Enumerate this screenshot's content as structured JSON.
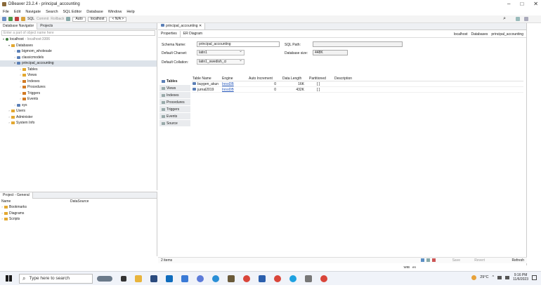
{
  "window": {
    "title": "DBeaver 23.2.4 - principal_accounting",
    "controls": [
      "–",
      "□",
      "✕"
    ]
  },
  "menu": [
    "File",
    "Edit",
    "Navigate",
    "Search",
    "SQL Editor",
    "Database",
    "Window",
    "Help"
  ],
  "toolbar": {
    "sql_label": "SQL",
    "commit_label": "Commit",
    "rollback_label": "Rollback",
    "auto_label": "Auto",
    "connection_label": "localhost",
    "schema_label": "< N/A >"
  },
  "navigator": {
    "tabs": [
      "Database Navigator",
      "Projects"
    ],
    "filter_placeholder": "Enter a part of object name here",
    "tree": [
      {
        "label": "localhost",
        "suffix": "- localhost:3306",
        "level": 0,
        "icon": "conn",
        "arrow": "▾"
      },
      {
        "label": "Databases",
        "level": 1,
        "icon": "folder",
        "arrow": "▾"
      },
      {
        "label": "bigmom_wholesale",
        "level": 2,
        "icon": "db",
        "arrow": "›"
      },
      {
        "label": "classicmodels",
        "level": 2,
        "icon": "db",
        "arrow": "›"
      },
      {
        "label": "principal_accounting",
        "level": 2,
        "icon": "db",
        "arrow": "▾",
        "selected": true
      },
      {
        "label": "Tables",
        "level": 3,
        "icon": "folder",
        "arrow": "›"
      },
      {
        "label": "Views",
        "level": 3,
        "icon": "folder",
        "arrow": "›"
      },
      {
        "label": "Indexes",
        "level": 3,
        "icon": "folder-b",
        "arrow": "›"
      },
      {
        "label": "Procedures",
        "level": 3,
        "icon": "folder-b",
        "arrow": "›"
      },
      {
        "label": "Triggers",
        "level": 3,
        "icon": "folder-b",
        "arrow": "›"
      },
      {
        "label": "Events",
        "level": 3,
        "icon": "folder-b",
        "arrow": "›"
      },
      {
        "label": "sys",
        "level": 2,
        "icon": "db",
        "arrow": "›"
      },
      {
        "label": "Users",
        "level": 1,
        "icon": "folder",
        "arrow": "›"
      },
      {
        "label": "Administer",
        "level": 1,
        "icon": "folder",
        "arrow": "›"
      },
      {
        "label": "System Info",
        "level": 1,
        "icon": "folder",
        "arrow": "›"
      }
    ]
  },
  "project": {
    "tab": "Project - General",
    "col_name": "Name",
    "col_source": "DataSource",
    "items": [
      "Bookmarks",
      "Diagrams",
      "Scripts"
    ]
  },
  "editor": {
    "tab": "principal_accounting",
    "subtabs": [
      "Properties",
      "ER Diagram"
    ],
    "breadcrumbs": [
      "localhost",
      "Databases",
      "principal_accounting"
    ],
    "schema_name_label": "Schema Name:",
    "schema_name_value": "principal_accounting",
    "sql_path_label": "SQL Path:",
    "sql_path_value": "",
    "charset_label": "Default Charset:",
    "charset_value": "latin1",
    "db_size_label": "Database size:",
    "db_size_value": "448K",
    "collation_label": "Default Collation:",
    "collation_value": "latin1_swedish_ci",
    "side_tabs": [
      "Tables",
      "Views",
      "Indexes",
      "Procedures",
      "Triggers",
      "Events",
      "Source"
    ],
    "columns": [
      "Table Name",
      "Engine",
      "Auto Increment",
      "Data Length",
      "Partitioned",
      "Description"
    ],
    "rows": [
      {
        "name": "buygen_akun",
        "engine": "InnoDB",
        "auto": "0",
        "length": "16K",
        "partitioned": "[ ]",
        "desc": ""
      },
      {
        "name": "jurnal2019",
        "engine": "InnoDB",
        "auto": "0",
        "length": "432K",
        "partitioned": "[ ]",
        "desc": ""
      }
    ],
    "status_count": "2 items",
    "status_actions": [
      "Save",
      "Revert",
      "Refresh"
    ],
    "locale": [
      "WIB",
      "en"
    ]
  },
  "taskbar": {
    "search_placeholder": "Type here to search",
    "weather": "29°C",
    "time": "9:16 PM",
    "date": "11/6/2023"
  }
}
